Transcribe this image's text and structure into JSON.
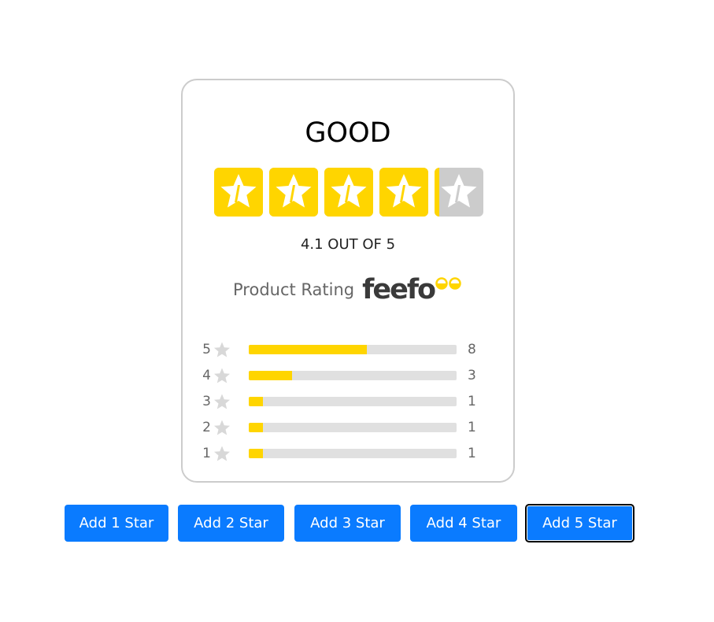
{
  "rating": {
    "label": "GOOD",
    "score": 4.1,
    "max": 5,
    "score_text": "4.1 OUT OF 5",
    "star_fill_color": "#ffd500",
    "star_empty_color": "#cccccc"
  },
  "product": {
    "label": "Product Rating",
    "brand": "feefo"
  },
  "distribution": [
    {
      "stars": "5",
      "count": "8",
      "fraction": 0.57
    },
    {
      "stars": "4",
      "count": "3",
      "fraction": 0.21
    },
    {
      "stars": "3",
      "count": "1",
      "fraction": 0.07
    },
    {
      "stars": "2",
      "count": "1",
      "fraction": 0.07
    },
    {
      "stars": "1",
      "count": "1",
      "fraction": 0.07
    }
  ],
  "buttons": [
    {
      "label": "Add 1 Star"
    },
    {
      "label": "Add 2 Star"
    },
    {
      "label": "Add 3 Star"
    },
    {
      "label": "Add 4 Star"
    },
    {
      "label": "Add 5 Star",
      "focused": true
    }
  ],
  "accent_color": "#0a7bff"
}
